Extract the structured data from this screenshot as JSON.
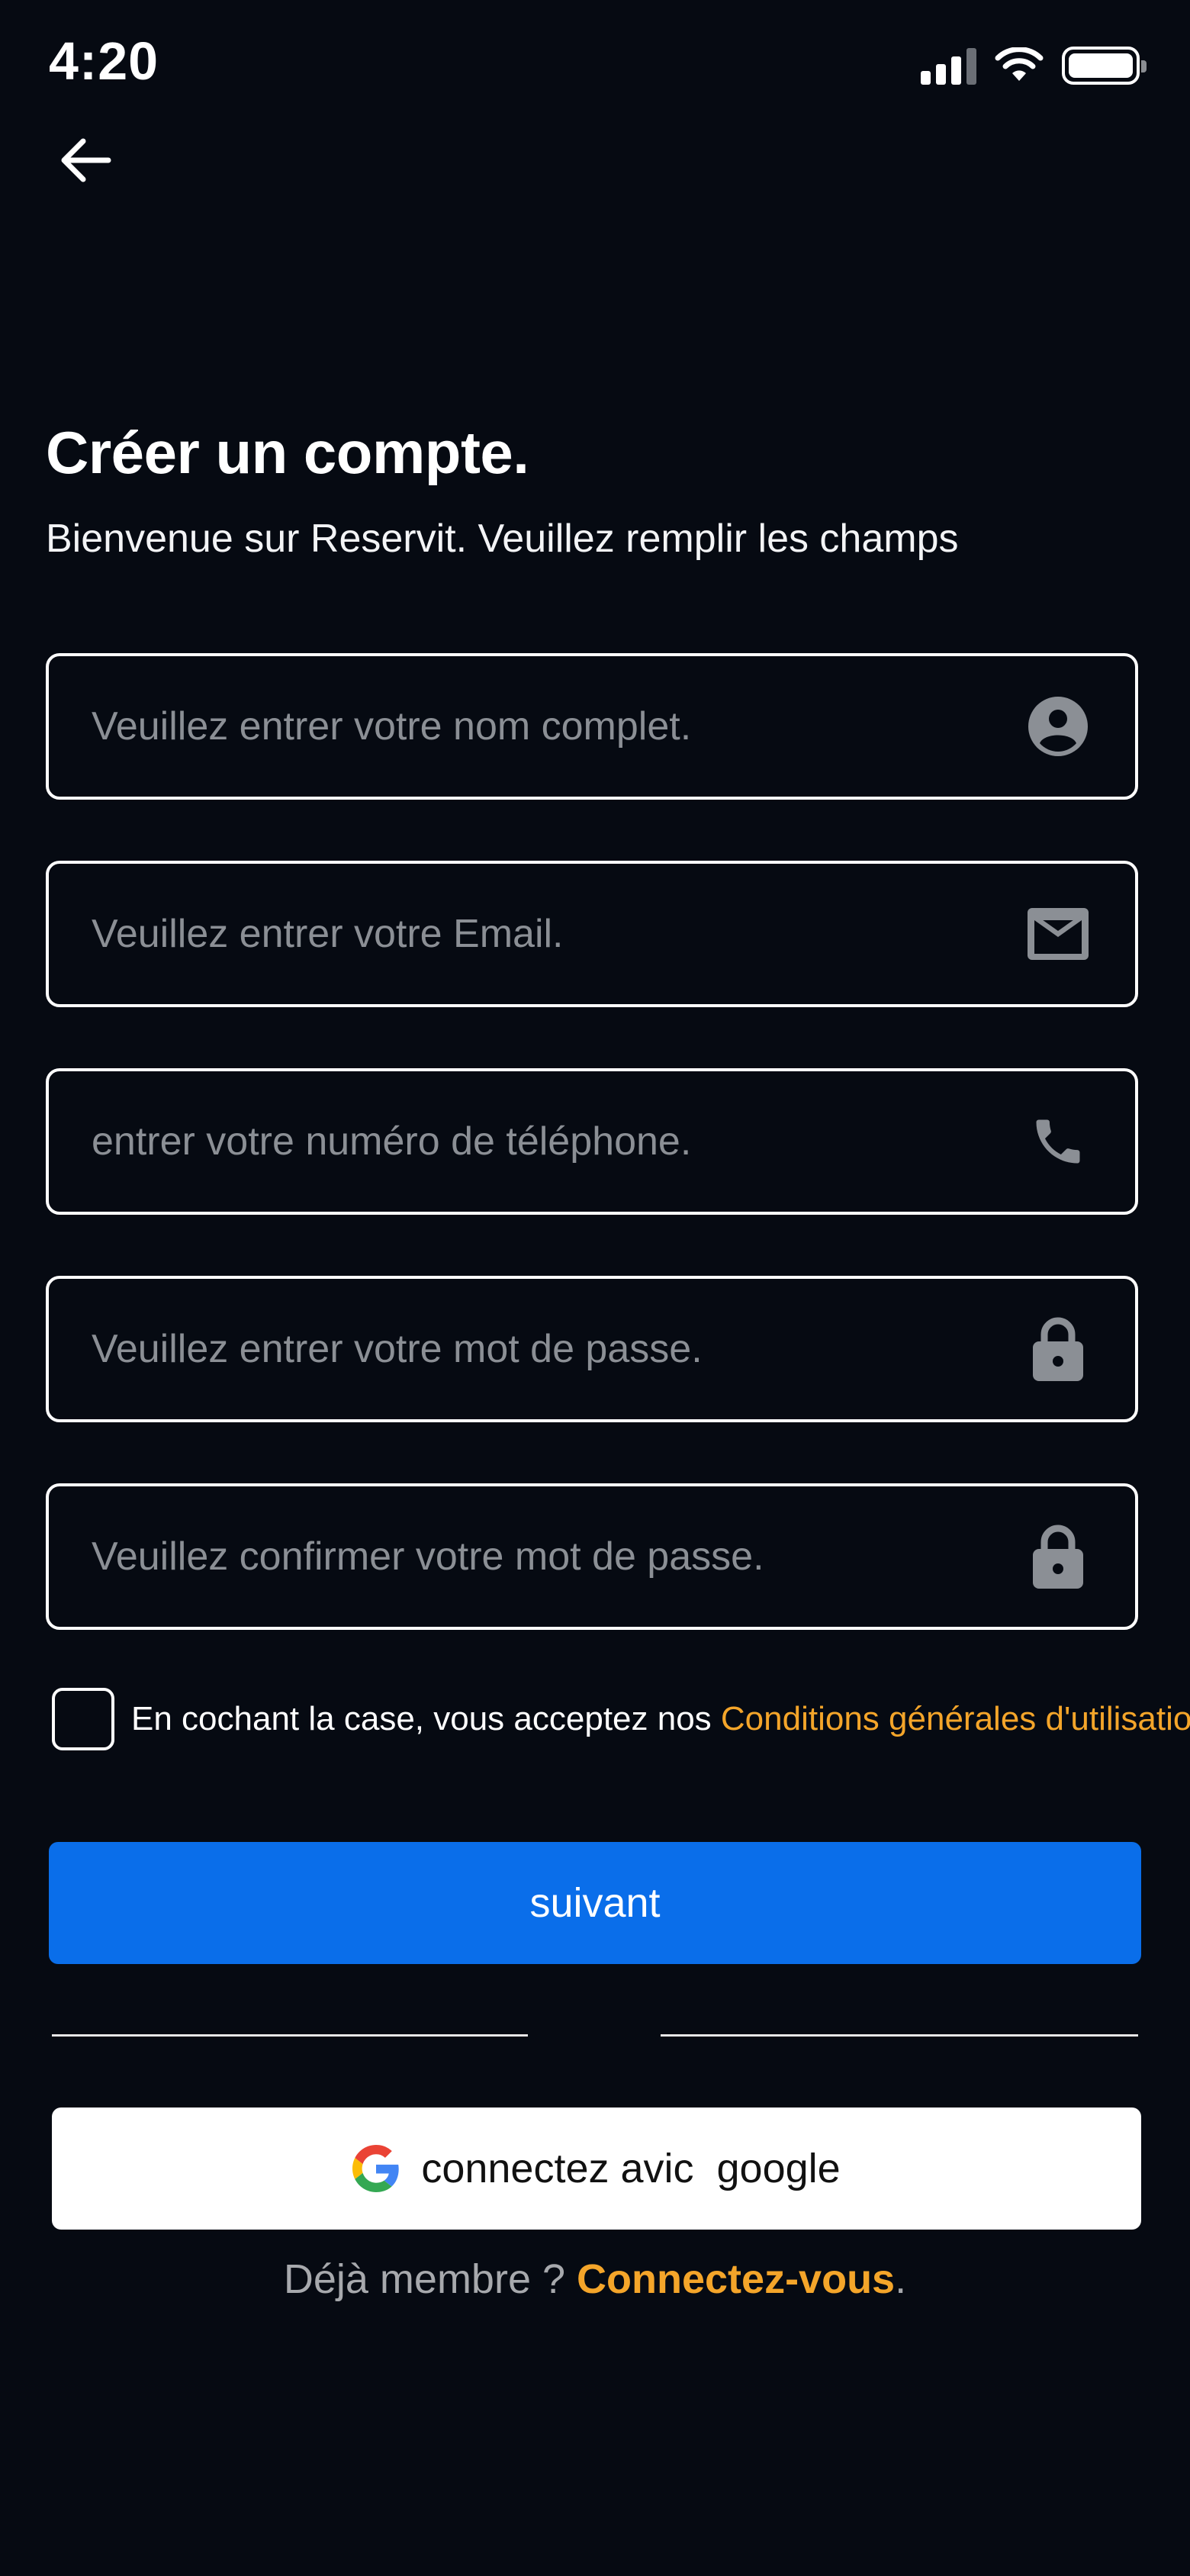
{
  "status_bar": {
    "time": "4:20",
    "icons": [
      "signal-icon",
      "wifi-icon",
      "battery-icon"
    ]
  },
  "nav": {
    "back_icon": "arrow-left-icon"
  },
  "header": {
    "title": "Créer un compte.",
    "subtitle": "Bienvenue sur Reservit. Veuillez remplir les champs"
  },
  "form": {
    "full_name": {
      "value": "",
      "placeholder": "Veuillez entrer votre nom complet.",
      "icon": "account-circle-icon"
    },
    "email": {
      "value": "",
      "placeholder": "Veuillez entrer votre Email.",
      "icon": "mail-icon"
    },
    "phone": {
      "value": "",
      "placeholder": "entrer votre numéro de téléphone.",
      "icon": "phone-icon"
    },
    "password": {
      "value": "",
      "placeholder": "Veuillez entrer votre mot de passe.",
      "icon": "lock-icon"
    },
    "confirm_password": {
      "value": "",
      "placeholder": "Veuillez confirmer votre mot de passe.",
      "icon": "lock-icon"
    }
  },
  "terms": {
    "checked": false,
    "text": "En cochant la case, vous acceptez nos ",
    "link": "Conditions générales d'utilisation."
  },
  "actions": {
    "next_label": "suivant",
    "google_label": "connectez avic  google",
    "google_icon": "google-logo-icon"
  },
  "login": {
    "prompt": "Déjà membre ? ",
    "link": "Connectez-vous",
    "suffix": "."
  },
  "colors": {
    "background": "#060a12",
    "primary": "#0a6eea",
    "accent": "#f4a52a",
    "placeholder": "#8b8f95"
  }
}
